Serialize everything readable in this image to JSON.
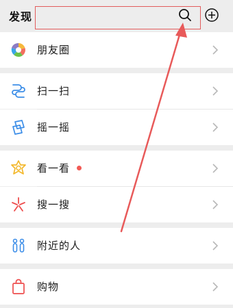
{
  "header": {
    "title": "发现",
    "search_icon": "search-icon",
    "add_icon": "plus-circle-icon"
  },
  "items": [
    {
      "label": "朋友圈",
      "icon": "moments-icon"
    },
    {
      "label": "扫一扫",
      "icon": "scan-icon"
    },
    {
      "label": "摇一摇",
      "icon": "shake-icon"
    },
    {
      "label": "看一看",
      "icon": "top-stories-icon",
      "has_badge_dot": true
    },
    {
      "label": "搜一搜",
      "icon": "search-star-icon"
    },
    {
      "label": "附近的人",
      "icon": "people-nearby-icon"
    },
    {
      "label": "购物",
      "icon": "shopping-bag-icon"
    }
  ],
  "colors": {
    "annotation": "#e25c5c",
    "badge": "#f25a55",
    "background": "#ededed"
  }
}
